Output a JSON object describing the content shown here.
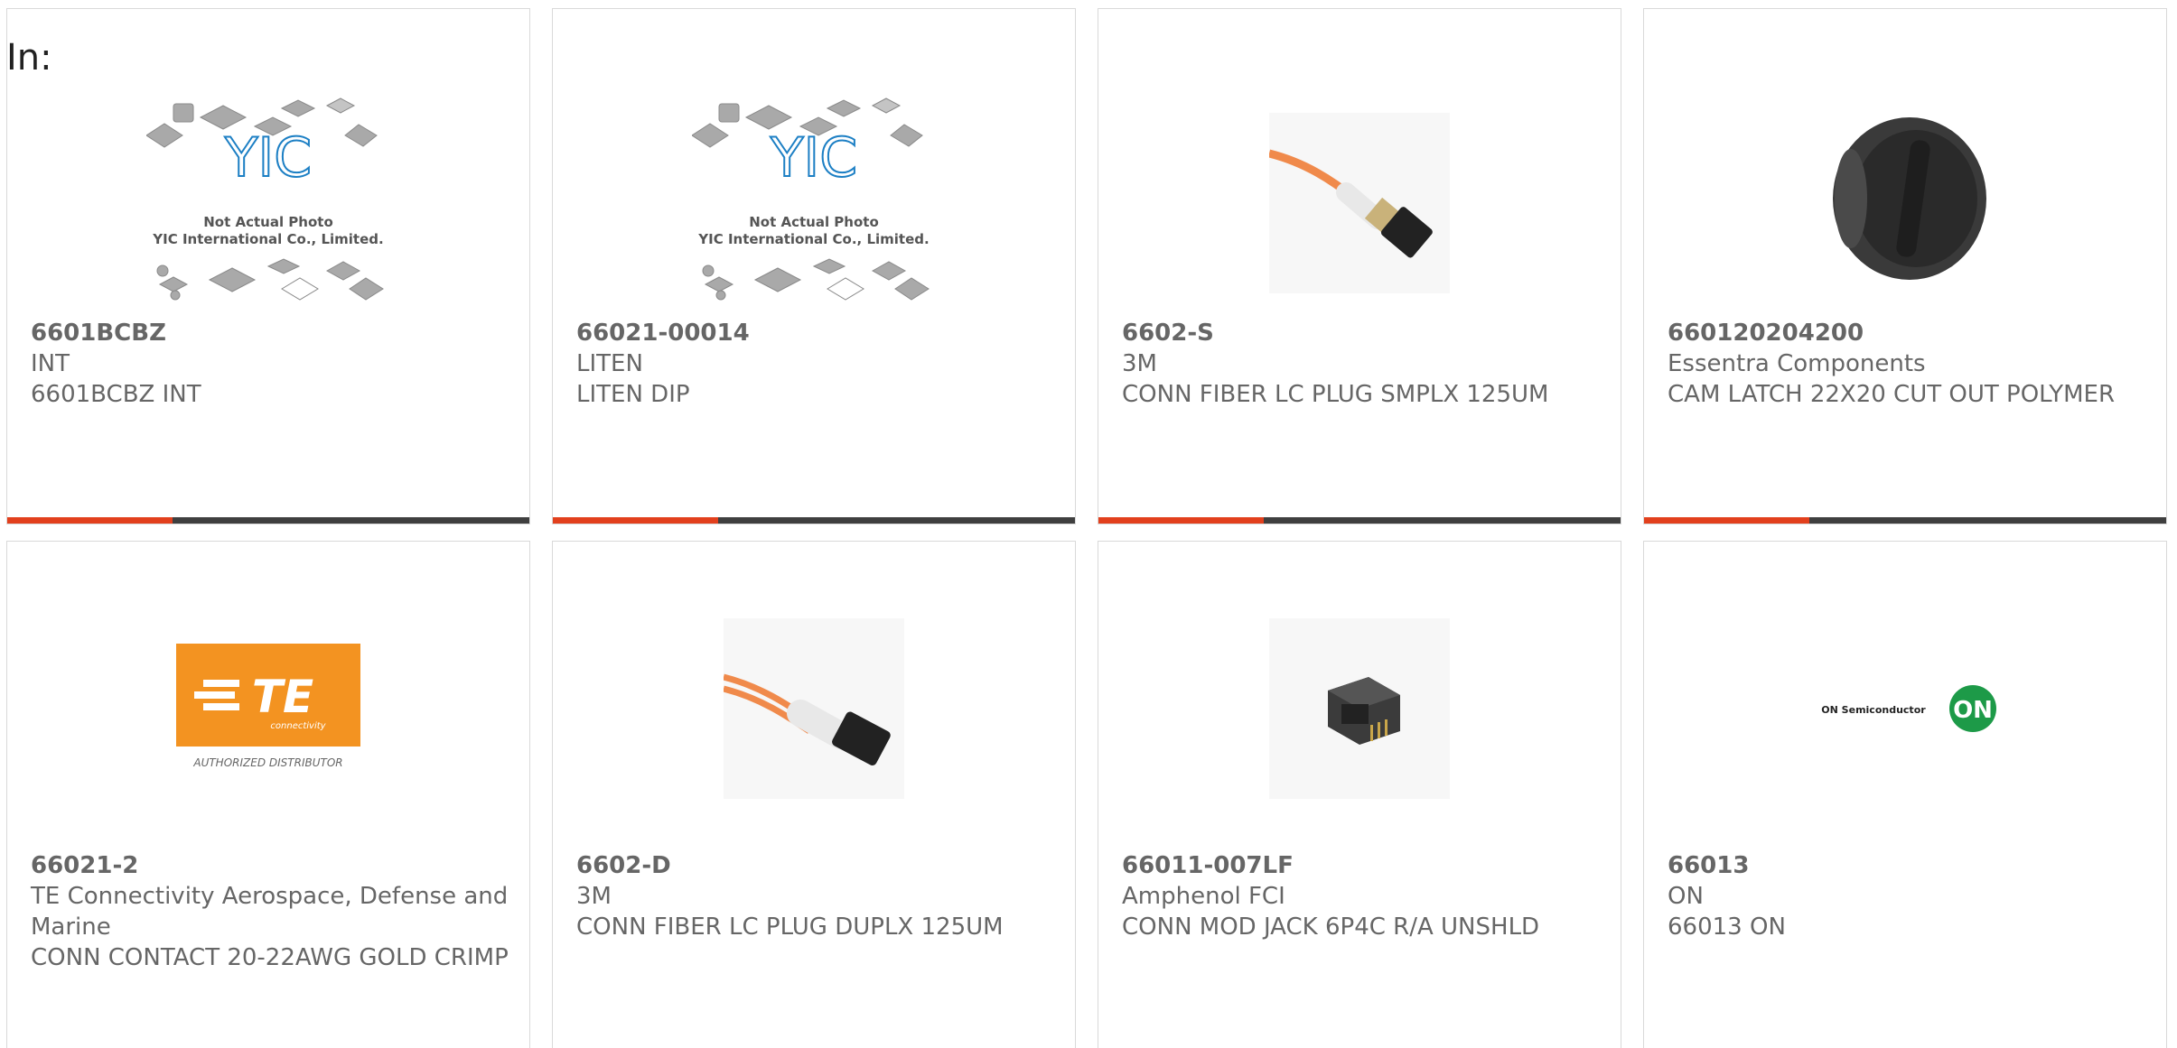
{
  "header": {
    "label": "In:"
  },
  "brand_colors": {
    "accent": "#e2401d",
    "bar": "#3f3f3f",
    "text": "#666666"
  },
  "products": [
    {
      "part_number": "6601BCBZ",
      "manufacturer": "INT",
      "description": "6601BCBZ INT",
      "image": "yic-placeholder",
      "placeholder": {
        "brand": "YIC",
        "line1": "Not Actual Photo",
        "line2": "YIC International Co., Limited."
      }
    },
    {
      "part_number": "66021-00014",
      "manufacturer": "LITEN",
      "description": "LITEN DIP",
      "image": "yic-placeholder",
      "placeholder": {
        "brand": "YIC",
        "line1": "Not Actual Photo",
        "line2": "YIC International Co., Limited."
      }
    },
    {
      "part_number": "6602-S",
      "manufacturer": "3M",
      "description": "CONN FIBER LC PLUG SMPLX 125UM",
      "image": "fiber-lc-simplex"
    },
    {
      "part_number": "660120204200",
      "manufacturer": "Essentra Components",
      "description": "CAM LATCH 22X20 CUT OUT POLYMER",
      "image": "cam-latch"
    },
    {
      "part_number": "66021-2",
      "manufacturer": "TE Connectivity Aerospace, Defense and Marine",
      "description": "CONN CONTACT 20-22AWG GOLD CRIMP",
      "image": "te-logo",
      "logo": {
        "mark": "TE",
        "sub": "connectivity",
        "caption": "AUTHORIZED DISTRIBUTOR"
      }
    },
    {
      "part_number": "6602-D",
      "manufacturer": "3M",
      "description": "CONN FIBER LC PLUG DUPLX 125UM",
      "image": "fiber-lc-duplex"
    },
    {
      "part_number": "66011-007LF",
      "manufacturer": "Amphenol FCI",
      "description": "CONN MOD JACK 6P4C R/A UNSHLD",
      "image": "modular-jack"
    },
    {
      "part_number": "66013",
      "manufacturer": "ON",
      "description": "66013 ON",
      "image": "on-semi-logo",
      "logo": {
        "text": "ON Semiconductor",
        "mark": "ON"
      }
    }
  ]
}
